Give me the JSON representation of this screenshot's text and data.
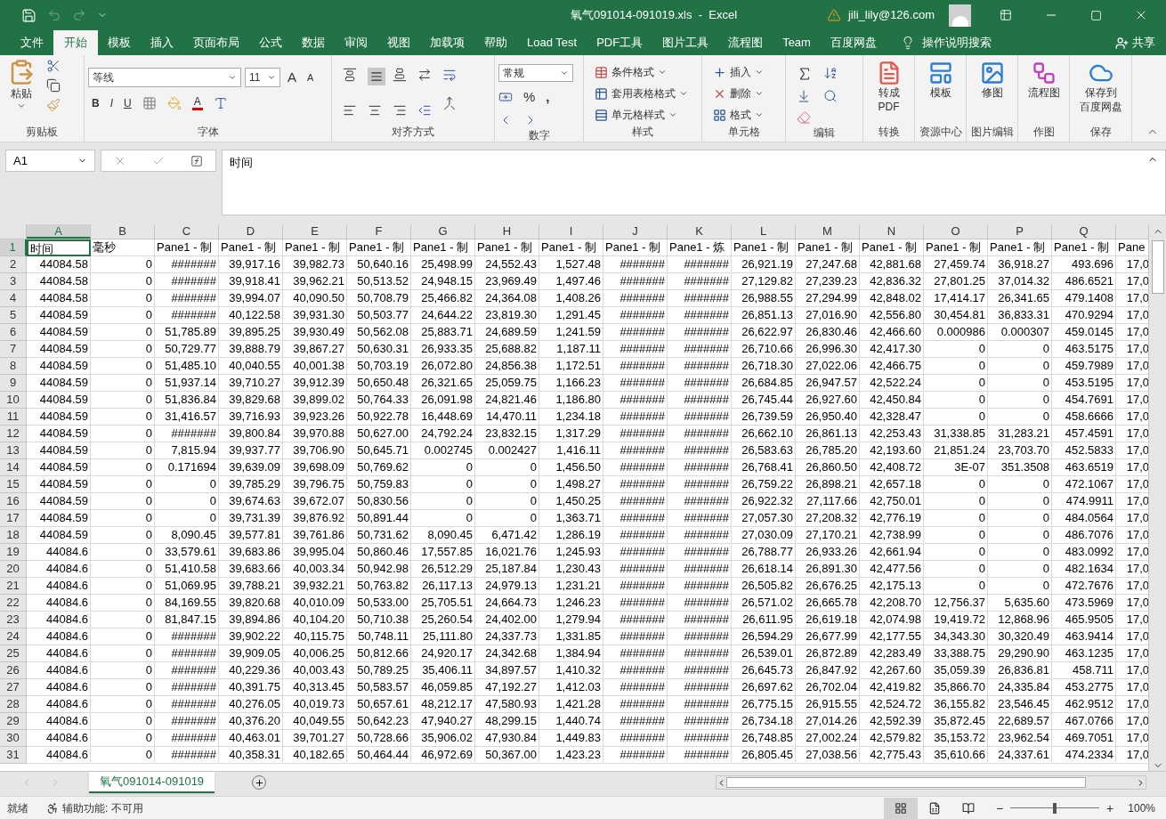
{
  "title_bar": {
    "title": "氧气091014-091019.xls  -  Excel",
    "user": "jili_lily@126.com"
  },
  "menu_tabs": [
    {
      "label": "文件",
      "selected": false
    },
    {
      "label": "开始",
      "selected": true
    },
    {
      "label": "模板",
      "selected": false
    },
    {
      "label": "插入",
      "selected": false
    },
    {
      "label": "页面布局",
      "selected": false
    },
    {
      "label": "公式",
      "selected": false
    },
    {
      "label": "数据",
      "selected": false
    },
    {
      "label": "审阅",
      "selected": false
    },
    {
      "label": "视图",
      "selected": false
    },
    {
      "label": "加载项",
      "selected": false
    },
    {
      "label": "帮助",
      "selected": false
    },
    {
      "label": "Load Test",
      "selected": false
    },
    {
      "label": "PDF工具",
      "selected": false
    },
    {
      "label": "图片工具",
      "selected": false
    },
    {
      "label": "流程图",
      "selected": false
    },
    {
      "label": "Team",
      "selected": false
    },
    {
      "label": "百度网盘",
      "selected": false
    }
  ],
  "tell_me": "操作说明搜索",
  "share": "共享",
  "ribbon": {
    "clipboard": {
      "paste": "粘贴",
      "label": "剪贴板"
    },
    "font": {
      "name": "等线",
      "size": "11",
      "grow": "A",
      "shrink": "A",
      "bold": "B",
      "italic": "I",
      "underline": "U",
      "font_color_letter": "A",
      "label": "字体"
    },
    "alignment": {
      "label": "对齐方式"
    },
    "number": {
      "format": "常规",
      "percent": "%",
      "comma": ",",
      "label": "数字"
    },
    "styles": {
      "items": [
        "条件格式",
        "套用表格格式",
        "单元格样式"
      ],
      "label": "样式"
    },
    "cells": {
      "items": [
        "插入",
        "删除",
        "格式"
      ],
      "label": "单元格"
    },
    "editing": {
      "label": "编辑"
    },
    "big_groups": [
      {
        "button": [
          "转成",
          "PDF"
        ],
        "label": "转换"
      },
      {
        "button": [
          "模板"
        ],
        "label": "资源中心"
      },
      {
        "button": [
          "修图"
        ],
        "label": "图片编辑"
      },
      {
        "button": [
          "流程图"
        ],
        "label": "作图"
      },
      {
        "button": [
          "保存到",
          "百度网盘"
        ],
        "label": "保存"
      }
    ]
  },
  "formula_bar": {
    "name_box": "A1",
    "content": "时间"
  },
  "sheet": {
    "columns": [
      {
        "label": "A",
        "selected": true
      },
      {
        "label": "B",
        "selected": false
      },
      {
        "label": "C",
        "selected": false
      },
      {
        "label": "D",
        "selected": false
      },
      {
        "label": "E",
        "selected": false
      },
      {
        "label": "F",
        "selected": false
      },
      {
        "label": "G",
        "selected": false
      },
      {
        "label": "H",
        "selected": false
      },
      {
        "label": "I",
        "selected": false
      },
      {
        "label": "J",
        "selected": false
      },
      {
        "label": "K",
        "selected": false
      },
      {
        "label": "L",
        "selected": false
      },
      {
        "label": "M",
        "selected": false
      },
      {
        "label": "N",
        "selected": false
      },
      {
        "label": "O",
        "selected": false
      },
      {
        "label": "P",
        "selected": false
      },
      {
        "label": "Q",
        "selected": false
      }
    ],
    "rows": [
      {
        "number": "1",
        "selected": true,
        "kind": "header",
        "cells": [
          "时间",
          "毫秒",
          "Pane1 - 制",
          "Pane1 - 制",
          "Pane1 - 制",
          "Pane1 - 制",
          "Pane1 - 制",
          "Pane1 - 制",
          "Pane1 - 制",
          "Pane1 - 制",
          "Pane1 - 炼",
          "Pane1 - 制",
          "Pane1 - 制",
          "Pane1 - 制",
          "Pane1 - 制",
          "Pane1 - 制",
          "Pane1 - 制",
          "Pane"
        ]
      },
      {
        "number": "2",
        "selected": false,
        "kind": "data",
        "cells": [
          "44084.58",
          "0",
          "#######",
          "39,917.16",
          "39,982.73",
          "50,640.16",
          "25,498.99",
          "24,552.43",
          "1,527.48",
          "#######",
          "#######",
          "26,921.19",
          "27,247.68",
          "42,881.68",
          "27,459.74",
          "36,918.27",
          "493.696",
          "17,0"
        ]
      },
      {
        "number": "3",
        "selected": false,
        "kind": "data",
        "cells": [
          "44084.58",
          "0",
          "#######",
          "39,918.41",
          "39,962.21",
          "50,513.52",
          "24,948.15",
          "23,969.49",
          "1,497.46",
          "#######",
          "#######",
          "27,129.82",
          "27,239.23",
          "42,836.32",
          "27,801.25",
          "37,014.32",
          "486.6521",
          "17,0"
        ]
      },
      {
        "number": "4",
        "selected": false,
        "kind": "data",
        "cells": [
          "44084.58",
          "0",
          "#######",
          "39,994.07",
          "40,090.50",
          "50,708.79",
          "25,466.82",
          "24,364.08",
          "1,408.26",
          "#######",
          "#######",
          "26,988.55",
          "27,294.99",
          "42,848.02",
          "17,414.17",
          "26,341.65",
          "479.1408",
          "17,0"
        ]
      },
      {
        "number": "5",
        "selected": false,
        "kind": "data",
        "cells": [
          "44084.59",
          "0",
          "#######",
          "40,122.58",
          "39,931.30",
          "50,503.77",
          "24,644.22",
          "23,819.30",
          "1,291.45",
          "#######",
          "#######",
          "26,851.13",
          "27,016.90",
          "42,556.80",
          "30,454.81",
          "36,833.31",
          "470.9294",
          "17,0"
        ]
      },
      {
        "number": "6",
        "selected": false,
        "kind": "data",
        "cells": [
          "44084.59",
          "0",
          "51,785.89",
          "39,895.25",
          "39,930.49",
          "50,562.08",
          "25,883.71",
          "24,689.59",
          "1,241.59",
          "#######",
          "#######",
          "26,622.97",
          "26,830.46",
          "42,466.60",
          "0.000986",
          "0.000307",
          "459.0145",
          "17,0"
        ]
      },
      {
        "number": "7",
        "selected": false,
        "kind": "data",
        "cells": [
          "44084.59",
          "0",
          "50,729.77",
          "39,888.79",
          "39,867.27",
          "50,630.31",
          "26,933.35",
          "25,688.82",
          "1,187.11",
          "#######",
          "#######",
          "26,710.66",
          "26,996.30",
          "42,417.30",
          "0",
          "0",
          "463.5175",
          "17,0"
        ]
      },
      {
        "number": "8",
        "selected": false,
        "kind": "data",
        "cells": [
          "44084.59",
          "0",
          "51,485.10",
          "40,040.55",
          "40,001.38",
          "50,703.19",
          "26,072.80",
          "24,856.38",
          "1,172.51",
          "#######",
          "#######",
          "26,718.30",
          "27,022.06",
          "42,466.75",
          "0",
          "0",
          "459.7989",
          "17,0"
        ]
      },
      {
        "number": "9",
        "selected": false,
        "kind": "data",
        "cells": [
          "44084.59",
          "0",
          "51,937.14",
          "39,710.27",
          "39,912.39",
          "50,650.48",
          "26,321.65",
          "25,059.75",
          "1,166.23",
          "#######",
          "#######",
          "26,684.85",
          "26,947.57",
          "42,522.24",
          "0",
          "0",
          "453.5195",
          "17,0"
        ]
      },
      {
        "number": "10",
        "selected": false,
        "kind": "data",
        "cells": [
          "44084.59",
          "0",
          "51,836.84",
          "39,829.68",
          "39,899.02",
          "50,764.33",
          "26,091.98",
          "24,821.46",
          "1,186.80",
          "#######",
          "#######",
          "26,745.44",
          "26,927.60",
          "42,450.84",
          "0",
          "0",
          "454.7691",
          "17,0"
        ]
      },
      {
        "number": "11",
        "selected": false,
        "kind": "data",
        "cells": [
          "44084.59",
          "0",
          "31,416.57",
          "39,716.93",
          "39,923.26",
          "50,922.78",
          "16,448.69",
          "14,470.11",
          "1,234.18",
          "#######",
          "#######",
          "26,739.59",
          "26,950.40",
          "42,328.47",
          "0",
          "0",
          "458.6666",
          "17,0"
        ]
      },
      {
        "number": "12",
        "selected": false,
        "kind": "data",
        "cells": [
          "44084.59",
          "0",
          "#######",
          "39,800.84",
          "39,970.88",
          "50,627.00",
          "24,792.24",
          "23,832.15",
          "1,317.29",
          "#######",
          "#######",
          "26,662.10",
          "26,861.13",
          "42,253.43",
          "31,338.85",
          "31,283.21",
          "457.4591",
          "17,0"
        ]
      },
      {
        "number": "13",
        "selected": false,
        "kind": "data",
        "cells": [
          "44084.59",
          "0",
          "7,815.94",
          "39,937.77",
          "39,706.90",
          "50,645.71",
          "0.002745",
          "0.002427",
          "1,416.11",
          "#######",
          "#######",
          "26,583.63",
          "26,785.20",
          "42,193.60",
          "21,851.24",
          "23,703.70",
          "452.5833",
          "17,0"
        ]
      },
      {
        "number": "14",
        "selected": false,
        "kind": "data",
        "cells": [
          "44084.59",
          "0",
          "0.171694",
          "39,639.09",
          "39,698.09",
          "50,769.62",
          "0",
          "0",
          "1,456.50",
          "#######",
          "#######",
          "26,768.41",
          "26,860.50",
          "42,408.72",
          "3E-07",
          "351.3508",
          "463.6519",
          "17,0"
        ]
      },
      {
        "number": "15",
        "selected": false,
        "kind": "data",
        "cells": [
          "44084.59",
          "0",
          "0",
          "39,785.29",
          "39,796.75",
          "50,759.83",
          "0",
          "0",
          "1,498.27",
          "#######",
          "#######",
          "26,759.22",
          "26,898.21",
          "42,657.18",
          "0",
          "0",
          "472.1067",
          "17,0"
        ]
      },
      {
        "number": "16",
        "selected": false,
        "kind": "data",
        "cells": [
          "44084.59",
          "0",
          "0",
          "39,674.63",
          "39,672.07",
          "50,830.56",
          "0",
          "0",
          "1,450.25",
          "#######",
          "#######",
          "26,922.32",
          "27,117.66",
          "42,750.01",
          "0",
          "0",
          "474.9911",
          "17,0"
        ]
      },
      {
        "number": "17",
        "selected": false,
        "kind": "data",
        "cells": [
          "44084.59",
          "0",
          "0",
          "39,731.39",
          "39,876.92",
          "50,891.44",
          "0",
          "0",
          "1,363.71",
          "#######",
          "#######",
          "27,057.30",
          "27,208.32",
          "42,776.19",
          "0",
          "0",
          "484.0564",
          "17,0"
        ]
      },
      {
        "number": "18",
        "selected": false,
        "kind": "data",
        "cells": [
          "44084.59",
          "0",
          "8,090.45",
          "39,577.81",
          "39,761.86",
          "50,731.62",
          "8,090.45",
          "6,471.42",
          "1,286.19",
          "#######",
          "#######",
          "27,030.09",
          "27,170.21",
          "42,738.99",
          "0",
          "0",
          "486.7076",
          "17,0"
        ]
      },
      {
        "number": "19",
        "selected": false,
        "kind": "data",
        "cells": [
          "44084.6",
          "0",
          "33,579.61",
          "39,683.86",
          "39,995.04",
          "50,860.46",
          "17,557.85",
          "16,021.76",
          "1,245.93",
          "#######",
          "#######",
          "26,788.77",
          "26,933.26",
          "42,661.94",
          "0",
          "0",
          "483.0992",
          "17,0"
        ]
      },
      {
        "number": "20",
        "selected": false,
        "kind": "data",
        "cells": [
          "44084.6",
          "0",
          "51,410.58",
          "39,683.66",
          "40,003.34",
          "50,942.98",
          "26,512.29",
          "25,187.84",
          "1,230.43",
          "#######",
          "#######",
          "26,618.14",
          "26,891.30",
          "42,477.56",
          "0",
          "0",
          "482.1634",
          "17,0"
        ]
      },
      {
        "number": "21",
        "selected": false,
        "kind": "data",
        "cells": [
          "44084.6",
          "0",
          "51,069.95",
          "39,788.21",
          "39,932.21",
          "50,763.82",
          "26,117.13",
          "24,979.13",
          "1,231.21",
          "#######",
          "#######",
          "26,505.82",
          "26,676.25",
          "42,175.13",
          "0",
          "0",
          "472.7676",
          "17,0"
        ]
      },
      {
        "number": "22",
        "selected": false,
        "kind": "data",
        "cells": [
          "44084.6",
          "0",
          "84,169.55",
          "39,820.68",
          "40,010.09",
          "50,533.00",
          "25,705.51",
          "24,664.73",
          "1,246.23",
          "#######",
          "#######",
          "26,571.02",
          "26,665.78",
          "42,208.70",
          "12,756.37",
          "5,635.60",
          "473.5969",
          "17,0"
        ]
      },
      {
        "number": "23",
        "selected": false,
        "kind": "data",
        "cells": [
          "44084.6",
          "0",
          "81,847.15",
          "39,894.86",
          "40,104.20",
          "50,710.38",
          "25,260.54",
          "24,402.00",
          "1,279.94",
          "#######",
          "#######",
          "26,611.95",
          "26,619.18",
          "42,074.98",
          "19,419.72",
          "12,868.96",
          "465.9505",
          "17,0"
        ]
      },
      {
        "number": "24",
        "selected": false,
        "kind": "data",
        "cells": [
          "44084.6",
          "0",
          "#######",
          "39,902.22",
          "40,115.75",
          "50,748.11",
          "25,111.80",
          "24,337.73",
          "1,331.85",
          "#######",
          "#######",
          "26,594.29",
          "26,677.99",
          "42,177.55",
          "34,343.30",
          "30,320.49",
          "463.9414",
          "17,0"
        ]
      },
      {
        "number": "25",
        "selected": false,
        "kind": "data",
        "cells": [
          "44084.6",
          "0",
          "#######",
          "39,909.05",
          "40,006.25",
          "50,812.66",
          "24,920.17",
          "24,342.68",
          "1,384.94",
          "#######",
          "#######",
          "26,539.01",
          "26,872.89",
          "42,283.49",
          "33,388.75",
          "29,290.90",
          "463.1235",
          "17,0"
        ]
      },
      {
        "number": "26",
        "selected": false,
        "kind": "data",
        "cells": [
          "44084.6",
          "0",
          "#######",
          "40,229.36",
          "40,003.43",
          "50,789.25",
          "35,406.11",
          "34,897.57",
          "1,410.32",
          "#######",
          "#######",
          "26,645.73",
          "26,847.92",
          "42,267.60",
          "35,059.39",
          "26,836.81",
          "458.711",
          "17,0"
        ]
      },
      {
        "number": "27",
        "selected": false,
        "kind": "data",
        "cells": [
          "44084.6",
          "0",
          "#######",
          "40,391.75",
          "40,313.45",
          "50,583.57",
          "46,059.85",
          "47,192.27",
          "1,412.03",
          "#######",
          "#######",
          "26,697.62",
          "26,702.04",
          "42,419.82",
          "35,866.70",
          "24,335.84",
          "453.2775",
          "17,0"
        ]
      },
      {
        "number": "28",
        "selected": false,
        "kind": "data",
        "cells": [
          "44084.6",
          "0",
          "#######",
          "40,276.05",
          "40,019.73",
          "50,657.61",
          "48,212.17",
          "47,580.93",
          "1,421.28",
          "#######",
          "#######",
          "26,775.15",
          "26,915.55",
          "42,524.72",
          "36,155.82",
          "23,546.45",
          "462.9512",
          "17,0"
        ]
      },
      {
        "number": "29",
        "selected": false,
        "kind": "data",
        "cells": [
          "44084.6",
          "0",
          "#######",
          "40,376.20",
          "40,049.55",
          "50,642.23",
          "47,940.27",
          "48,299.15",
          "1,440.74",
          "#######",
          "#######",
          "26,734.18",
          "27,014.26",
          "42,592.39",
          "35,872.45",
          "22,689.57",
          "467.0766",
          "17,0"
        ]
      },
      {
        "number": "30",
        "selected": false,
        "kind": "data",
        "cells": [
          "44084.6",
          "0",
          "#######",
          "40,463.01",
          "39,701.27",
          "50,728.66",
          "35,906.02",
          "47,930.84",
          "1,449.83",
          "#######",
          "#######",
          "26,748.85",
          "27,002.24",
          "42,579.82",
          "35,153.72",
          "23,962.54",
          "469.7051",
          "17,0"
        ]
      },
      {
        "number": "31",
        "selected": false,
        "kind": "data",
        "cells": [
          "44084.6",
          "0",
          "#######",
          "40,358.31",
          "40,182.65",
          "50,464.44",
          "46,972.69",
          "50,367.00",
          "1,423.23",
          "#######",
          "#######",
          "26,805.45",
          "27,038.56",
          "42,775.43",
          "35,610.66",
          "24,337.61",
          "474.2334",
          "17,0"
        ]
      }
    ]
  },
  "sheet_tabs": [
    {
      "label": "氧气091014-091019",
      "selected": true
    }
  ],
  "status_bar": {
    "ready": "就绪",
    "accessibility": "辅助功能: 不可用",
    "view_buttons": [
      {
        "selected": true
      },
      {
        "selected": false
      },
      {
        "selected": false
      }
    ],
    "zoom": {
      "minus": "−",
      "plus": "+",
      "level": 0.5,
      "reading": "100%"
    }
  }
}
